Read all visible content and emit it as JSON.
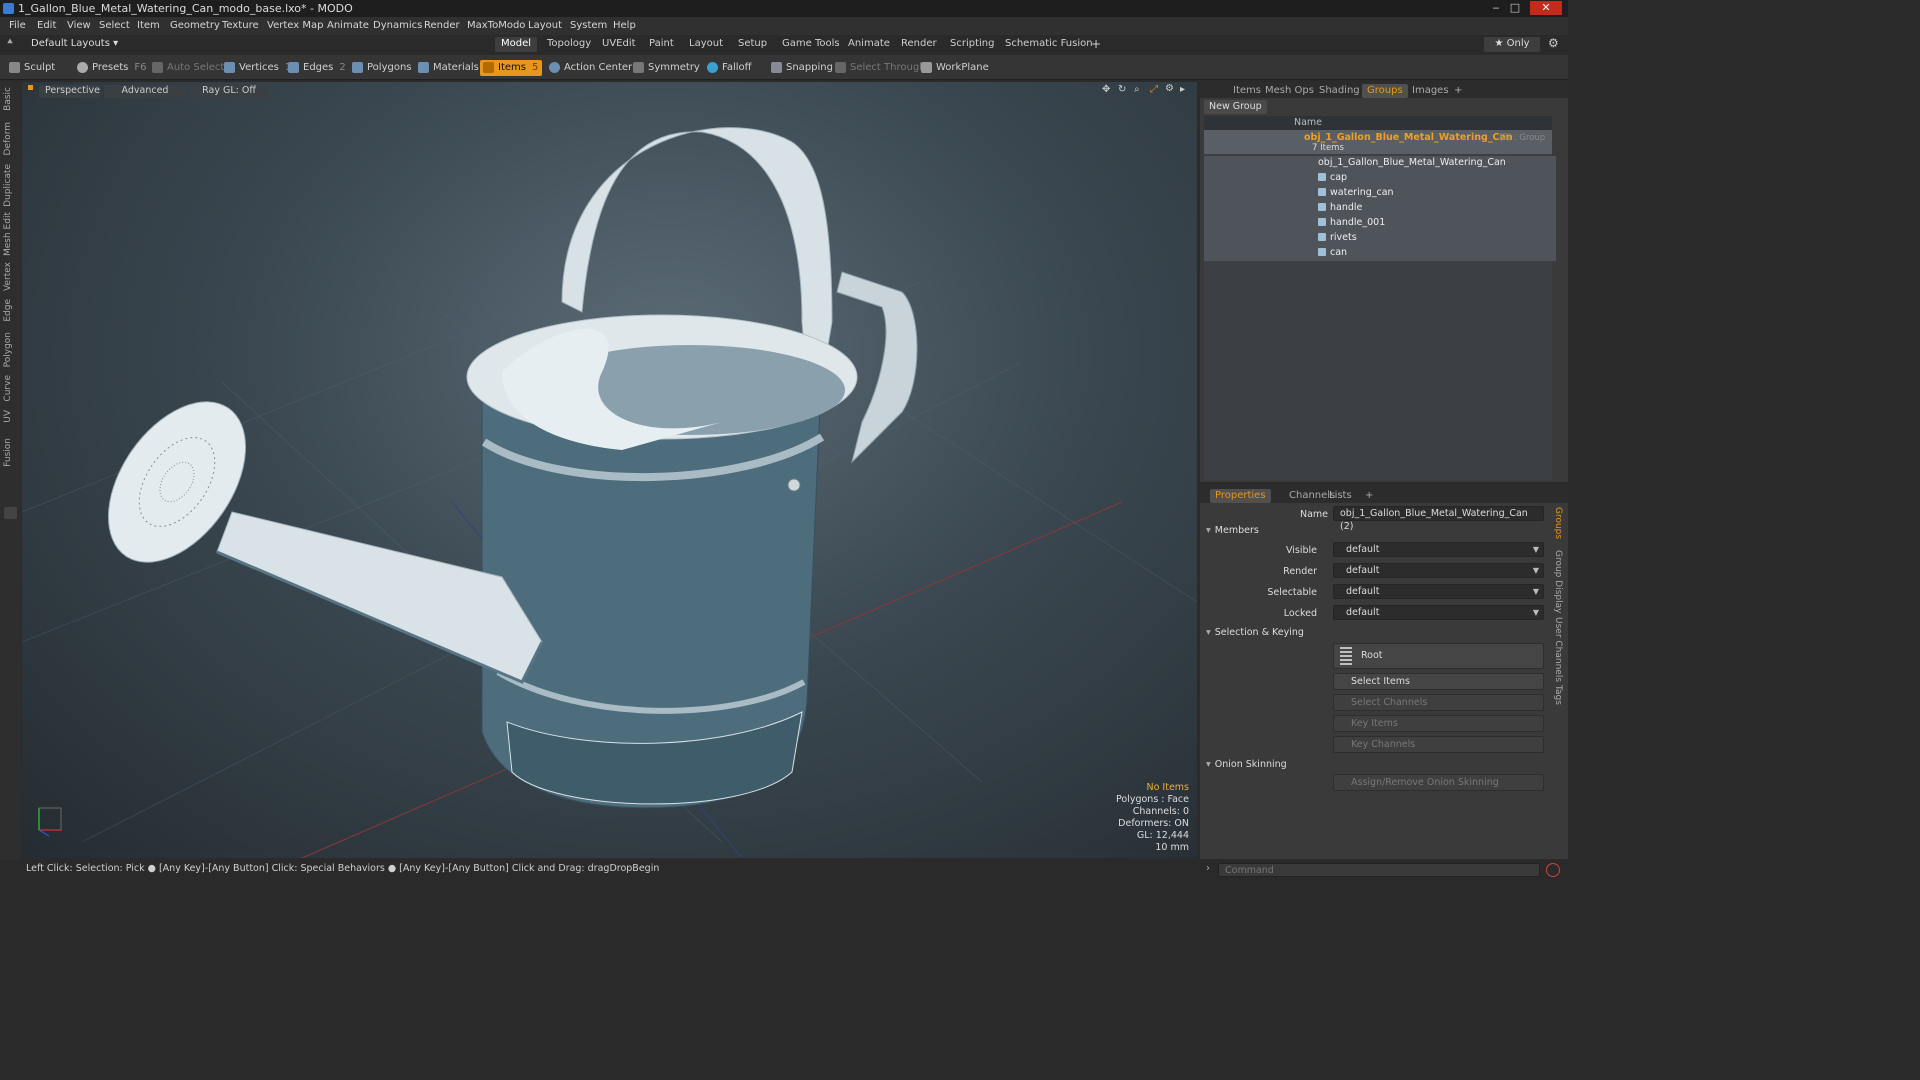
{
  "window": {
    "title": "1_Gallon_Blue_Metal_Watering_Can_modo_base.lxo* - MODO",
    "min": "‒",
    "max": "□",
    "close": "✕"
  },
  "menu": [
    "File",
    "Edit",
    "View",
    "Select",
    "Item",
    "Geometry",
    "Texture",
    "Vertex Map",
    "Animate",
    "Dynamics",
    "Render",
    "MaxToModo",
    "Layout",
    "System",
    "Help"
  ],
  "layouts": {
    "label": "Default Layouts ▾",
    "only": "★ Only"
  },
  "tabs": [
    "Model",
    "Topology",
    "UVEdit",
    "Paint",
    "Layout",
    "Setup",
    "Game Tools",
    "Animate",
    "Render",
    "Scripting",
    "Schematic Fusion",
    "+"
  ],
  "toolbar": {
    "sculpt": "Sculpt",
    "presets": "Presets",
    "presets_key": "F6",
    "auto_select": "Auto Select",
    "vertices": "Vertices",
    "vertices_key": "1",
    "edges": "Edges",
    "edges_key": "2",
    "polygons": "Polygons",
    "materials": "Materials",
    "items": "Items",
    "items_key": "5",
    "action_center": "Action Center",
    "symmetry": "Symmetry",
    "falloff": "Falloff",
    "snapping": "Snapping",
    "select_through": "Select Through",
    "workplane": "WorkPlane"
  },
  "left_tabs": [
    "Basic",
    "Deform",
    "Duplicate",
    "Mesh Edit",
    "Vertex",
    "Edge",
    "Polygon",
    "Curve",
    "UV",
    "Fusion"
  ],
  "viewport": {
    "view": "Perspective",
    "shading": "Advanced",
    "raygl": "Ray GL: Off",
    "no_items": "No Items",
    "stats": [
      "Polygons : Face",
      "Channels: 0",
      "Deformers: ON",
      "GL: 12,444",
      "10 mm"
    ]
  },
  "status": "Left Click: Selection: Pick ● [Any Key]-[Any Button] Click: Special Behaviors ● [Any Key]-[Any Button] Click and Drag: dragDropBegin",
  "panel_tabs": [
    "Items",
    "Mesh Ops",
    "Shading",
    "Groups",
    "Images",
    "+"
  ],
  "groups": {
    "new_group": "New Group",
    "col_name": "Name",
    "root_name": "obj_1_Gallon_Blue_Metal_Watering_Can",
    "root_suffix": "(2) : Group",
    "count": "7 Items",
    "children": [
      "obj_1_Gallon_Blue_Metal_Watering_Can",
      "cap",
      "watering_can",
      "handle",
      "handle_001",
      "rivets",
      "can"
    ]
  },
  "props_tabs": [
    "Properties",
    "Channels",
    "Lists",
    "+"
  ],
  "props": {
    "name_label": "Name",
    "name_value": "obj_1_Gallon_Blue_Metal_Watering_Can (2)",
    "members": "Members",
    "visible": "Visible",
    "render": "Render",
    "selectable": "Selectable",
    "locked": "Locked",
    "dropdown_value": "default",
    "sel_keying": "Selection & Keying",
    "root": "Root",
    "select_items": "Select Items",
    "select_channels": "Select Channels",
    "key_items": "Key Items",
    "key_channels": "Key Channels",
    "onion": "Onion Skinning",
    "assign_onion": "Assign/Remove Onion Skinning"
  },
  "side_tabs": [
    "Groups",
    "Group Display",
    "User Channels",
    "Tags"
  ],
  "command_placeholder": "Command",
  "colors": {
    "accent": "#e8961e",
    "can": "#4d6c7c"
  }
}
